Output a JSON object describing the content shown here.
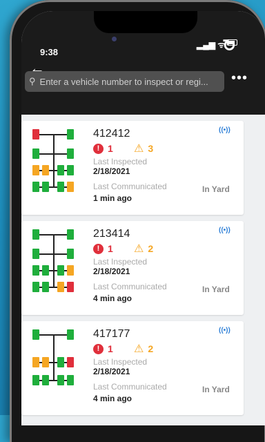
{
  "status_bar": {
    "time": "9:38",
    "signal_glyph": "▂▄▆ ᯤ"
  },
  "header": {
    "back_icon": "arrow-left-icon",
    "refresh_icon": "refresh-icon",
    "more_icon": "more-icon"
  },
  "search": {
    "placeholder": "Enter a vehicle number to inspect or regi..."
  },
  "colors": {
    "good": "#1fae3c",
    "critical": "#e02f3b",
    "warning": "#f5a623",
    "link": "#2f80d7"
  },
  "vehicles": [
    {
      "number": "412412",
      "critical_count": "1",
      "warning_count": "3",
      "last_inspected_label": "Last Inspected",
      "last_inspected": "2/18/2021",
      "last_communicated_label": "Last Communicated",
      "last_communicated": "1 min ago",
      "location": "In Yard",
      "tires": [
        "red",
        "green",
        "green",
        "green",
        "orange",
        "orange",
        "green",
        "green",
        "green",
        "green",
        "green",
        "orange"
      ]
    },
    {
      "number": "213414",
      "critical_count": "1",
      "warning_count": "2",
      "last_inspected_label": "Last Inspected",
      "last_inspected": "2/18/2021",
      "last_communicated_label": "Last Communicated",
      "last_communicated": "4 min ago",
      "location": "In Yard",
      "tires": [
        "green",
        "green",
        "green",
        "green",
        "green",
        "green",
        "green",
        "orange",
        "green",
        "green",
        "orange",
        "red"
      ]
    },
    {
      "number": "417177",
      "critical_count": "1",
      "warning_count": "2",
      "last_inspected_label": "Last Inspected",
      "last_inspected": "2/18/2021",
      "last_communicated_label": "Last Communicated",
      "last_communicated": "4 min ago",
      "location": "In Yard",
      "tires": [
        "green",
        "green",
        "orange",
        "orange",
        "green",
        "red",
        "green",
        "green",
        "green",
        "green"
      ]
    }
  ]
}
